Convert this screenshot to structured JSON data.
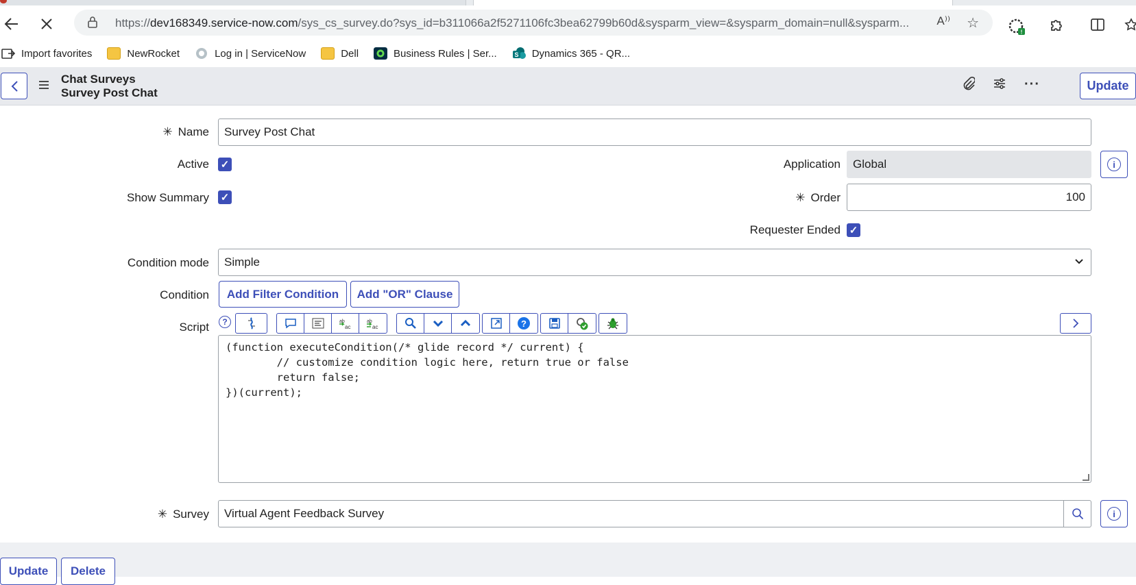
{
  "browser": {
    "url_prefix": "https://",
    "url_host": "dev168349.service-now.com",
    "url_path": "/sys_cs_survey.do?sys_id=b311066a2f5271106fc3bea62799b60d&sysparm_view=&sysparm_domain=null&sysparm...",
    "bookmarks": [
      {
        "label": "Import favorites",
        "icon": "import-icon"
      },
      {
        "label": "NewRocket",
        "icon": "folder-icon"
      },
      {
        "label": "Log in | ServiceNow",
        "icon": "servicenow-icon"
      },
      {
        "label": "Dell",
        "icon": "folder-icon"
      },
      {
        "label": "Business Rules | Ser...",
        "icon": "servicenow-green-icon"
      },
      {
        "label": "Dynamics 365 - QR...",
        "icon": "sharepoint-icon"
      }
    ]
  },
  "header": {
    "title_line1": "Chat Surveys",
    "title_line2": "Survey Post Chat",
    "update_label": "Update"
  },
  "form": {
    "name": {
      "label": "Name",
      "value": "Survey Post Chat"
    },
    "active": {
      "label": "Active",
      "checked": true
    },
    "show_summary": {
      "label": "Show Summary",
      "checked": true
    },
    "application": {
      "label": "Application",
      "value": "Global"
    },
    "order": {
      "label": "Order",
      "value": "100"
    },
    "requester_ended": {
      "label": "Requester Ended",
      "checked": true
    },
    "condition_mode": {
      "label": "Condition mode",
      "value": "Simple"
    },
    "condition": {
      "label": "Condition",
      "add_filter": "Add Filter Condition",
      "add_or": "Add \"OR\" Clause"
    },
    "script": {
      "label": "Script",
      "lines": [
        "(function executeCondition(/* glide record */ current) {",
        "        // customize condition logic here, return true or false",
        "        return false;",
        "})(current);"
      ]
    },
    "survey": {
      "label": "Survey",
      "value": "Virtual Agent Feedback Survey"
    }
  },
  "footer": {
    "update_label": "Update",
    "delete_label": "Delete"
  },
  "colors": {
    "accent": "#3d4fb8",
    "header_bg": "#e8eaee"
  }
}
